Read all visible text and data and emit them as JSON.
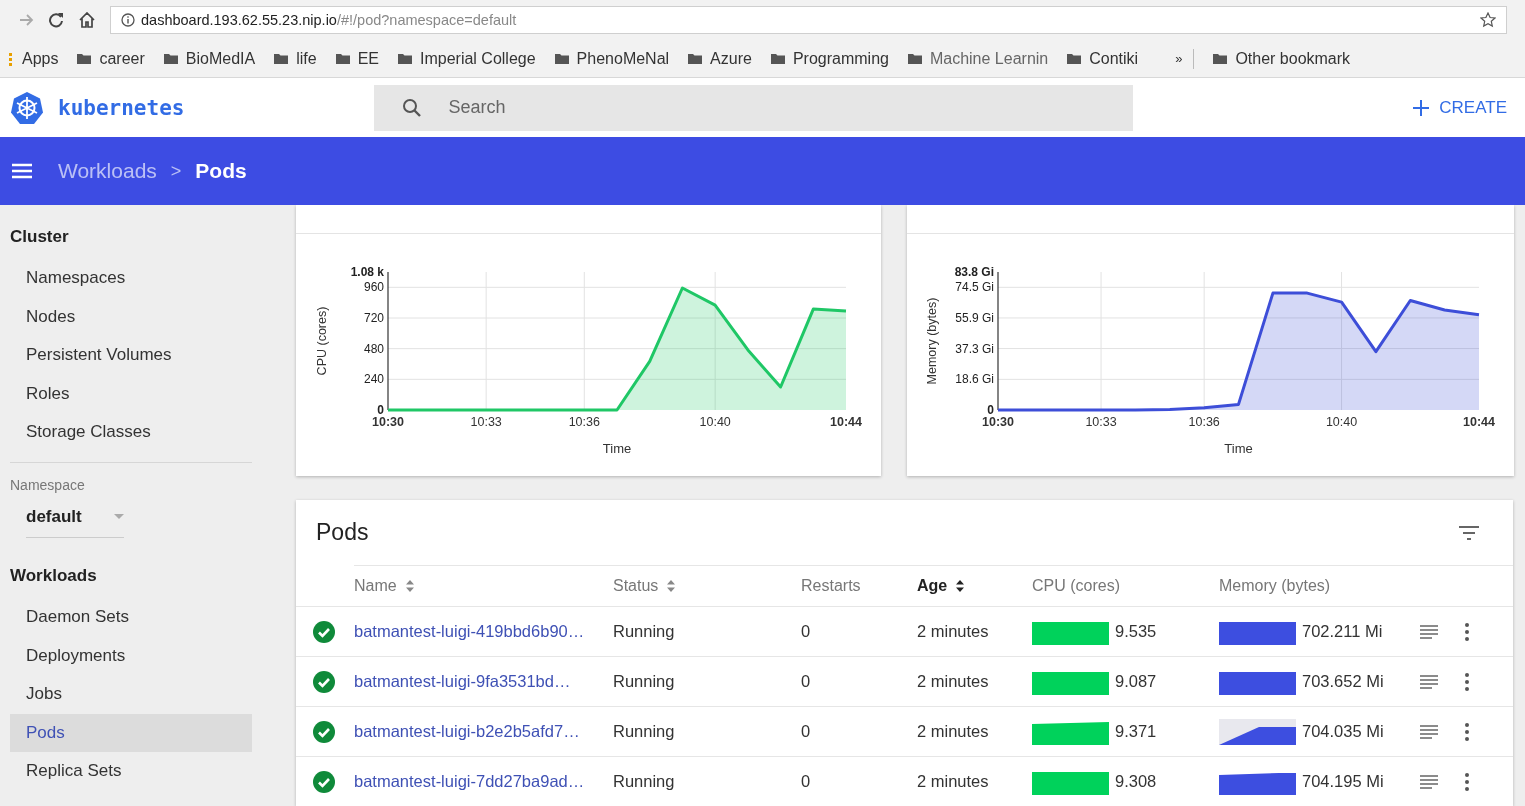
{
  "browser": {
    "url_host": "dashboard.193.62.55.23.nip.io",
    "url_path": "/#!/pod?namespace=default",
    "bookmarks": [
      {
        "label": "Apps",
        "kind": "apps"
      },
      {
        "label": "career",
        "kind": "folder"
      },
      {
        "label": "BioMedIA",
        "kind": "folder"
      },
      {
        "label": "life",
        "kind": "folder"
      },
      {
        "label": "EE",
        "kind": "folder"
      },
      {
        "label": "Imperial College",
        "kind": "folder"
      },
      {
        "label": "PhenoMeNal",
        "kind": "folder"
      },
      {
        "label": "Azure",
        "kind": "folder"
      },
      {
        "label": "Programming",
        "kind": "folder"
      },
      {
        "label": "Machine Learnin",
        "kind": "folder"
      },
      {
        "label": "Contiki",
        "kind": "folder"
      },
      {
        "label": "»",
        "kind": "overflow"
      },
      {
        "label": "Other bookmark",
        "kind": "folder"
      }
    ]
  },
  "app_bar": {
    "logo_text": "kubernetes",
    "search": {
      "placeholder": "Search"
    },
    "create_button": "CREATE"
  },
  "toolbar": {
    "separator": ">",
    "breadcrumbs": [
      {
        "label": "Workloads",
        "selected": false
      },
      {
        "label": "Pods",
        "selected": true
      }
    ]
  },
  "sidebar": {
    "cluster": {
      "title": "Cluster",
      "items": [
        {
          "label": "Namespaces",
          "selected": false
        },
        {
          "label": "Nodes",
          "selected": false
        },
        {
          "label": "Persistent Volumes",
          "selected": false
        },
        {
          "label": "Roles",
          "selected": false
        },
        {
          "label": "Storage Classes",
          "selected": false
        }
      ]
    },
    "namespace": {
      "label": "Namespace",
      "value": "default"
    },
    "workloads": {
      "title": "Workloads",
      "items": [
        {
          "label": "Daemon Sets",
          "selected": false
        },
        {
          "label": "Deployments",
          "selected": false
        },
        {
          "label": "Jobs",
          "selected": false
        },
        {
          "label": "Pods",
          "selected": true
        },
        {
          "label": "Replica Sets",
          "selected": false
        }
      ]
    }
  },
  "charts": [
    {
      "chart_data": {
        "type": "area",
        "xlabel": "Time",
        "ylabel": "CPU (cores)",
        "categories": [
          "10:30",
          null,
          null,
          "10:33",
          null,
          null,
          "10:36",
          null,
          null,
          null,
          "10:40",
          null,
          null,
          null,
          "10:44"
        ],
        "series": [
          {
            "color": "#1fc766",
            "values": [
              0,
              0,
              0,
              0,
              0,
              0,
              0,
              0,
              380,
              955,
              820,
              470,
              180,
              790,
              775
            ]
          }
        ],
        "ylim": [
          0,
          1080
        ],
        "grid": true,
        "yticks": [
          0,
          240,
          480,
          720,
          960,
          {
            "value": 1080,
            "label": "1.08 k"
          }
        ]
      }
    },
    {
      "chart_data": {
        "type": "area",
        "xlabel": "Time",
        "ylabel": "Memory (bytes)",
        "categories": [
          "10:30",
          null,
          null,
          "10:33",
          null,
          null,
          "10:36",
          null,
          null,
          null,
          "10:40",
          null,
          null,
          null,
          "10:44"
        ],
        "series": [
          {
            "color": "#3d4ed8",
            "values": [
              0,
              0,
              0,
              0,
              0,
              0.3,
              1.4,
              3.4,
              71,
              71,
              65.5,
              35.4,
              66.5,
              60.7,
              57.8
            ]
          }
        ],
        "ylim": [
          0,
          83.8
        ],
        "grid": true,
        "yticks": [
          0,
          {
            "value": 18.6,
            "label": "18.6 Gi"
          },
          {
            "value": 37.3,
            "label": "37.3 Gi"
          },
          {
            "value": 55.9,
            "label": "55.9 Gi"
          },
          {
            "value": 74.5,
            "label": "74.5 Gi"
          },
          {
            "value": 83.8,
            "label": "83.8 Gi"
          }
        ]
      }
    }
  ],
  "pods": {
    "title": "Pods",
    "columns": [
      {
        "label": "Name",
        "sortable": true,
        "sorted": false
      },
      {
        "label": "Status",
        "sortable": true,
        "sorted": false
      },
      {
        "label": "Restarts",
        "sortable": false,
        "sorted": false
      },
      {
        "label": "Age",
        "sortable": true,
        "sorted": true
      },
      {
        "label": "CPU (cores)",
        "sortable": false,
        "sorted": false
      },
      {
        "label": "Memory (bytes)",
        "sortable": false,
        "sorted": false
      }
    ],
    "rows": [
      {
        "name": "batmantest-luigi-419bbd6b90…",
        "status": "Running",
        "restarts": "0",
        "age": "2 minutes",
        "cpu": "9.535",
        "memory": "702.211 Mi"
      },
      {
        "name": "batmantest-luigi-9fa3531bd…",
        "status": "Running",
        "restarts": "0",
        "age": "2 minutes",
        "cpu": "9.087",
        "memory": "703.652 Mi"
      },
      {
        "name": "batmantest-luigi-b2e2b5afd7…",
        "status": "Running",
        "restarts": "0",
        "age": "2 minutes",
        "cpu": "9.371",
        "memory": "704.035 Mi"
      },
      {
        "name": "batmantest-luigi-7dd27ba9ad…",
        "status": "Running",
        "restarts": "0",
        "age": "2 minutes",
        "cpu": "9.308",
        "memory": "704.195 Mi"
      }
    ]
  }
}
